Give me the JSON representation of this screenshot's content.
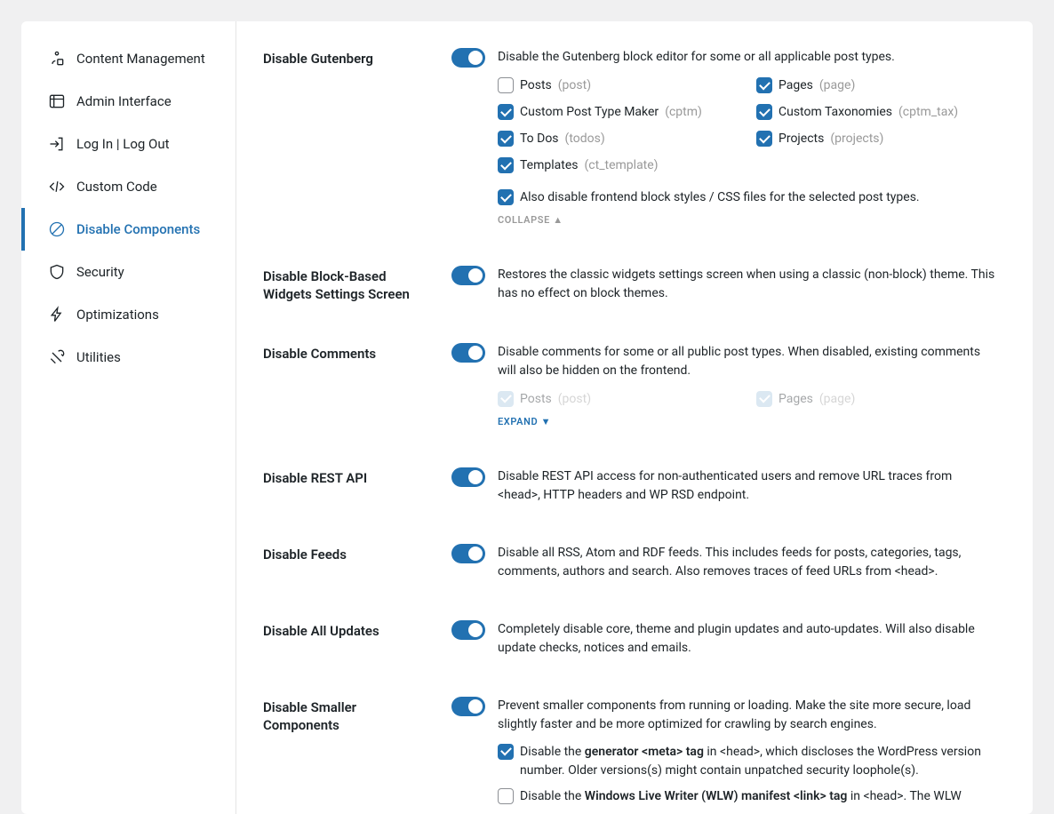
{
  "sidebar": {
    "items": [
      {
        "label": "Content Management"
      },
      {
        "label": "Admin Interface"
      },
      {
        "label": "Log In | Log Out"
      },
      {
        "label": "Custom Code"
      },
      {
        "label": "Disable Components"
      },
      {
        "label": "Security"
      },
      {
        "label": "Optimizations"
      },
      {
        "label": "Utilities"
      }
    ]
  },
  "settings": {
    "gutenberg": {
      "title": "Disable Gutenberg",
      "desc": "Disable the Gutenberg block editor for some or all applicable post types.",
      "post_types": [
        {
          "label": "Posts",
          "slug": "(post)",
          "checked": false
        },
        {
          "label": "Pages",
          "slug": "(page)",
          "checked": true
        },
        {
          "label": "Custom Post Type Maker",
          "slug": "(cptm)",
          "checked": true
        },
        {
          "label": "Custom Taxonomies",
          "slug": "(cptm_tax)",
          "checked": true
        },
        {
          "label": "To Dos",
          "slug": "(todos)",
          "checked": true
        },
        {
          "label": "Projects",
          "slug": "(projects)",
          "checked": true
        },
        {
          "label": "Templates",
          "slug": "(ct_template)",
          "checked": true
        }
      ],
      "extra": "Also disable frontend block styles / CSS files for the selected post types.",
      "collapse": "COLLAPSE ▲"
    },
    "block_widgets": {
      "title": "Disable Block-Based Widgets Settings Screen",
      "desc": "Restores the classic widgets settings screen when using a classic (non-block) theme. This has no effect on block themes."
    },
    "comments": {
      "title": "Disable Comments",
      "desc": "Disable comments for some or all public post types. When disabled, existing comments will also be hidden on the frontend.",
      "post_types": [
        {
          "label": "Posts",
          "slug": "(post)"
        },
        {
          "label": "Pages",
          "slug": "(page)"
        }
      ],
      "expand": "EXPAND ▼"
    },
    "rest": {
      "title": "Disable REST API",
      "desc": "Disable REST API access for non-authenticated users and remove URL traces from <head>, HTTP headers and WP RSD endpoint."
    },
    "feeds": {
      "title": "Disable Feeds",
      "desc": "Disable all RSS, Atom and RDF feeds. This includes feeds for posts, categories, tags, comments, authors and search. Also removes traces of feed URLs from <head>."
    },
    "updates": {
      "title": "Disable All Updates",
      "desc": "Completely disable core, theme and plugin updates and auto-updates. Will also disable update checks, notices and emails."
    },
    "smaller": {
      "title": "Disable Smaller Components",
      "desc": "Prevent smaller components from running or loading. Make the site more secure, load slightly faster and be more optimized for crawling by search engines.",
      "items": [
        {
          "checked": true,
          "pre": "Disable the ",
          "bold": "generator <meta> tag",
          "post": " in <head>, which discloses the WordPress version number. Older versions(s) might contain unpatched security loophole(s)."
        },
        {
          "checked": false,
          "pre": "Disable the ",
          "bold": "Windows Live Writer (WLW) manifest <link> tag",
          "post": " in <head>. The WLW"
        }
      ]
    }
  }
}
